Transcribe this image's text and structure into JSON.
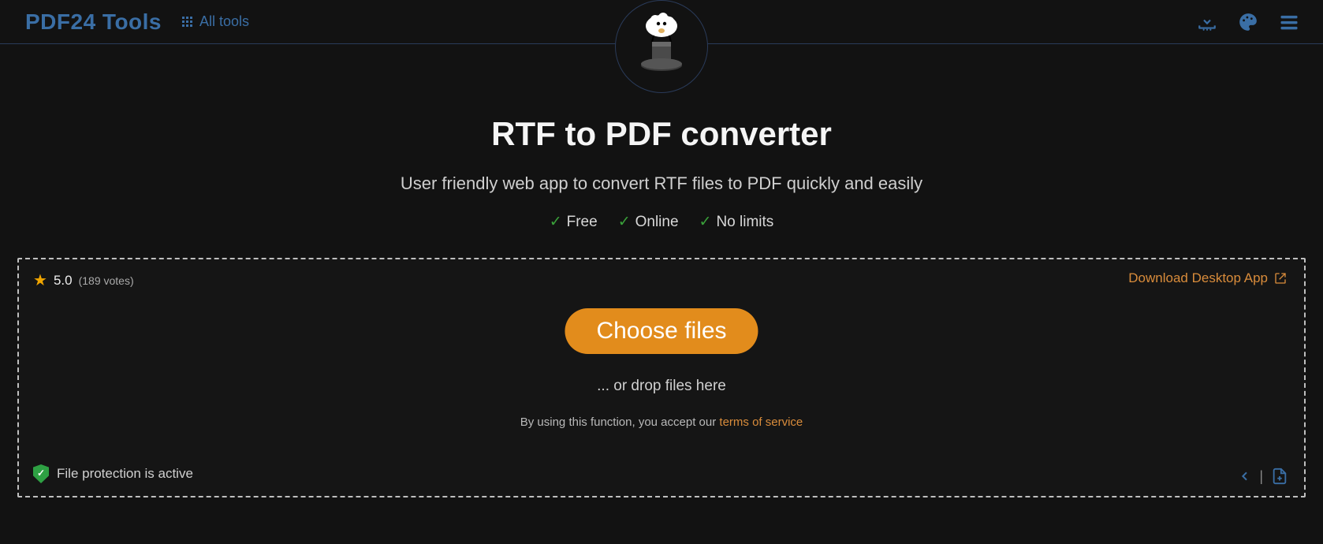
{
  "header": {
    "brand": "PDF24 Tools",
    "all_tools_label": "All tools"
  },
  "hero": {
    "title": "RTF to PDF converter",
    "subtitle": "User friendly web app to convert RTF files to PDF quickly and easily",
    "features": [
      "Free",
      "Online",
      "No limits"
    ]
  },
  "rating": {
    "score": "5.0",
    "votes_label": "(189 votes)"
  },
  "desktop_link_label": "Download Desktop App",
  "choose_files_label": "Choose files",
  "drop_hint": "... or drop files here",
  "tos_prefix": "By using this function, you accept our ",
  "tos_link_label": "terms of service",
  "file_protection_label": "File protection is active",
  "colors": {
    "accent_blue": "#3a6ea5",
    "accent_orange": "#e28c1c",
    "link_orange": "#d98c3b"
  }
}
